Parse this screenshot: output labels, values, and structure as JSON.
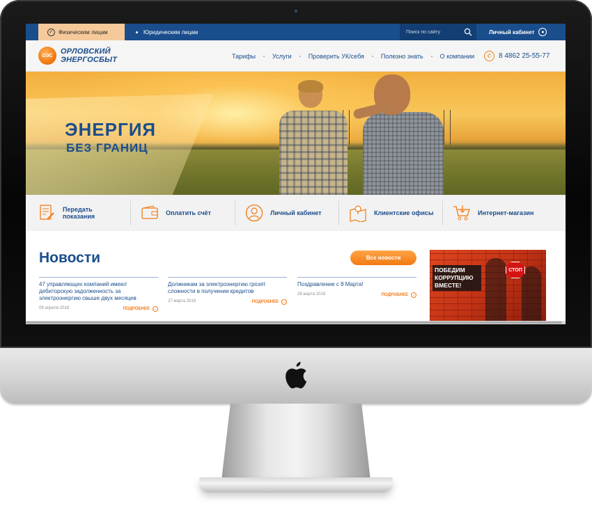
{
  "topbar": {
    "tab_individuals": "Физическим лицам",
    "tab_legal": "Юридическим лицам",
    "search_placeholder": "Поиск по сайту",
    "cabinet_label": "Личный кабинет"
  },
  "header": {
    "logo_badge": "ОЭС",
    "logo_line1": "ОРЛОВСКИЙ",
    "logo_line2": "ЭНЕРГОСБЫТ",
    "nav": [
      "Тарифы",
      "Услуги",
      "Проверить УК/себя",
      "Полезно знать",
      "О компании"
    ],
    "phone": "8 4862 25-55-77"
  },
  "hero": {
    "title": "ЭНЕРГИЯ",
    "subtitle": "БЕЗ ГРАНИЦ"
  },
  "quick_links": [
    {
      "icon": "document-pen-icon",
      "line1": "Передать",
      "line2": "показания"
    },
    {
      "icon": "wallet-icon",
      "line1": "Оплатить счёт",
      "line2": ""
    },
    {
      "icon": "user-circle-icon",
      "line1": "Личный кабинет",
      "line2": ""
    },
    {
      "icon": "map-pin-icon",
      "line1": "Клиентские офисы",
      "line2": ""
    },
    {
      "icon": "shopping-cart-icon",
      "line1": "Интернет-магазин",
      "line2": ""
    }
  ],
  "news": {
    "title": "Новости",
    "all_button": "Все новости",
    "more_label": "ПОДРОБНЕЕ",
    "items": [
      {
        "headline": "47 управляющих компаний имеют дебиторскую задолженность за электроэнергию свыше двух месяцев",
        "date": "09 апреля 2018"
      },
      {
        "headline": "Должникам за электроэнергию грозят сложности в получении кредитов",
        "date": "27 марта 2018"
      },
      {
        "headline": "Поздравление с 8 Марта!",
        "date": "26 марта 2018"
      }
    ]
  },
  "banner": {
    "text": "ПОБЕДИМ КОРРУПЦИЮ ВМЕСТЕ!",
    "stop_sign": "СТОП"
  },
  "colors": {
    "brand_blue": "#1a4d8c",
    "accent_orange": "#f27a12"
  }
}
